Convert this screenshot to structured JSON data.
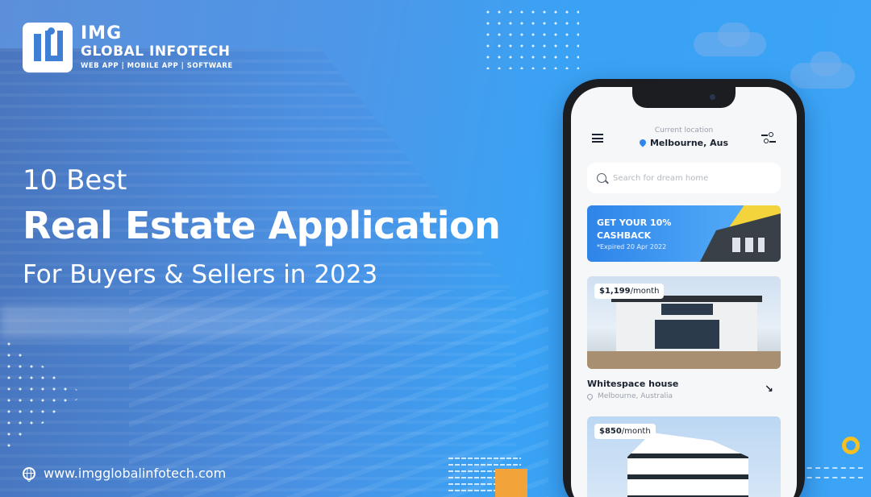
{
  "brand": {
    "logo_line1": "IMG",
    "logo_line2": "GLOBAL INFOTECH",
    "tagline": "WEB APP | MOBILE APP | SOFTWARE"
  },
  "headline": {
    "line1": "10 Best",
    "line2": "Real Estate Application",
    "line3": "For Buyers & Sellers in 2023"
  },
  "website": "www.imgglobalinfotech.com",
  "colors": {
    "background": "#3ba4f6",
    "accent_orange": "#f2a33a",
    "accent_yellow": "#f5c021",
    "app_blue": "#2f86f0"
  },
  "app": {
    "location_caption": "Current location",
    "location_value": "Melbourne, Aus",
    "search_placeholder": "Search for dream home",
    "promo": {
      "line1": "GET YOUR 10%",
      "line2": "CASHBACK",
      "expiry": "*Expired 20 Apr 2022"
    },
    "listings": [
      {
        "price": "$1,199",
        "unit": "/month",
        "title": "Whitespace house",
        "location": "Melbourne, Australia"
      },
      {
        "price": "$850",
        "unit": "/month"
      }
    ],
    "icons": [
      "menu-icon",
      "location-pin-icon",
      "filter-icon",
      "search-icon",
      "arrow-icon"
    ]
  }
}
